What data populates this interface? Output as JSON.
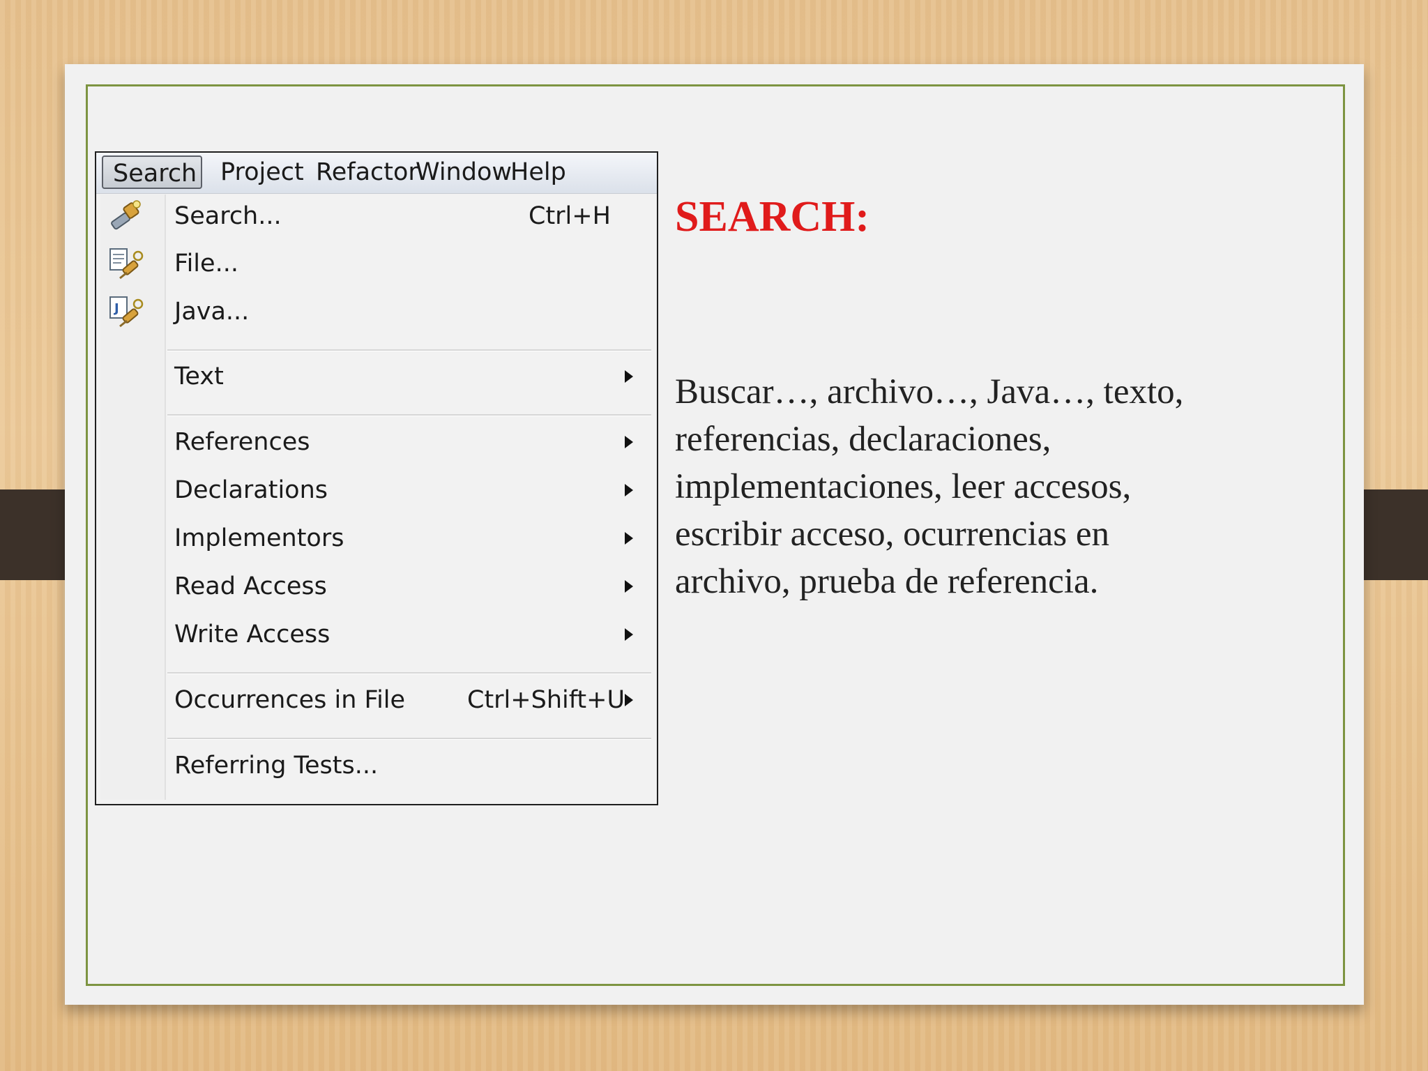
{
  "menubar": {
    "items": [
      "Search",
      "Project",
      "Refactor",
      "Window",
      "Help"
    ],
    "active": "Search"
  },
  "menu": {
    "search": {
      "label": "Search...",
      "shortcut": "Ctrl+H",
      "icon": "search-flashlight-icon"
    },
    "file": {
      "label": "File...",
      "icon": "file-search-icon"
    },
    "java": {
      "label": "Java...",
      "icon": "java-search-icon"
    },
    "text": {
      "label": "Text",
      "submenu": true
    },
    "references": {
      "label": "References",
      "submenu": true
    },
    "declarations": {
      "label": "Declarations",
      "submenu": true
    },
    "implementors": {
      "label": "Implementors",
      "submenu": true
    },
    "read_access": {
      "label": "Read Access",
      "submenu": true
    },
    "write_access": {
      "label": "Write Access",
      "submenu": true
    },
    "occurrences": {
      "label": "Occurrences in File",
      "shortcut": "Ctrl+Shift+U",
      "submenu": true
    },
    "referring_tests": {
      "label": "Referring Tests..."
    }
  },
  "slide": {
    "title": "SEARCH:",
    "body": "Buscar…, archivo…, Java…, texto, referencias, declaraciones, implementaciones, leer accesos, escribir acceso, ocurrencias en archivo, prueba de referencia."
  },
  "colors": {
    "title": "#e01b1b",
    "frame_border": "#7d9441",
    "strap": "#3c3129",
    "card": "#f1f1f1"
  }
}
